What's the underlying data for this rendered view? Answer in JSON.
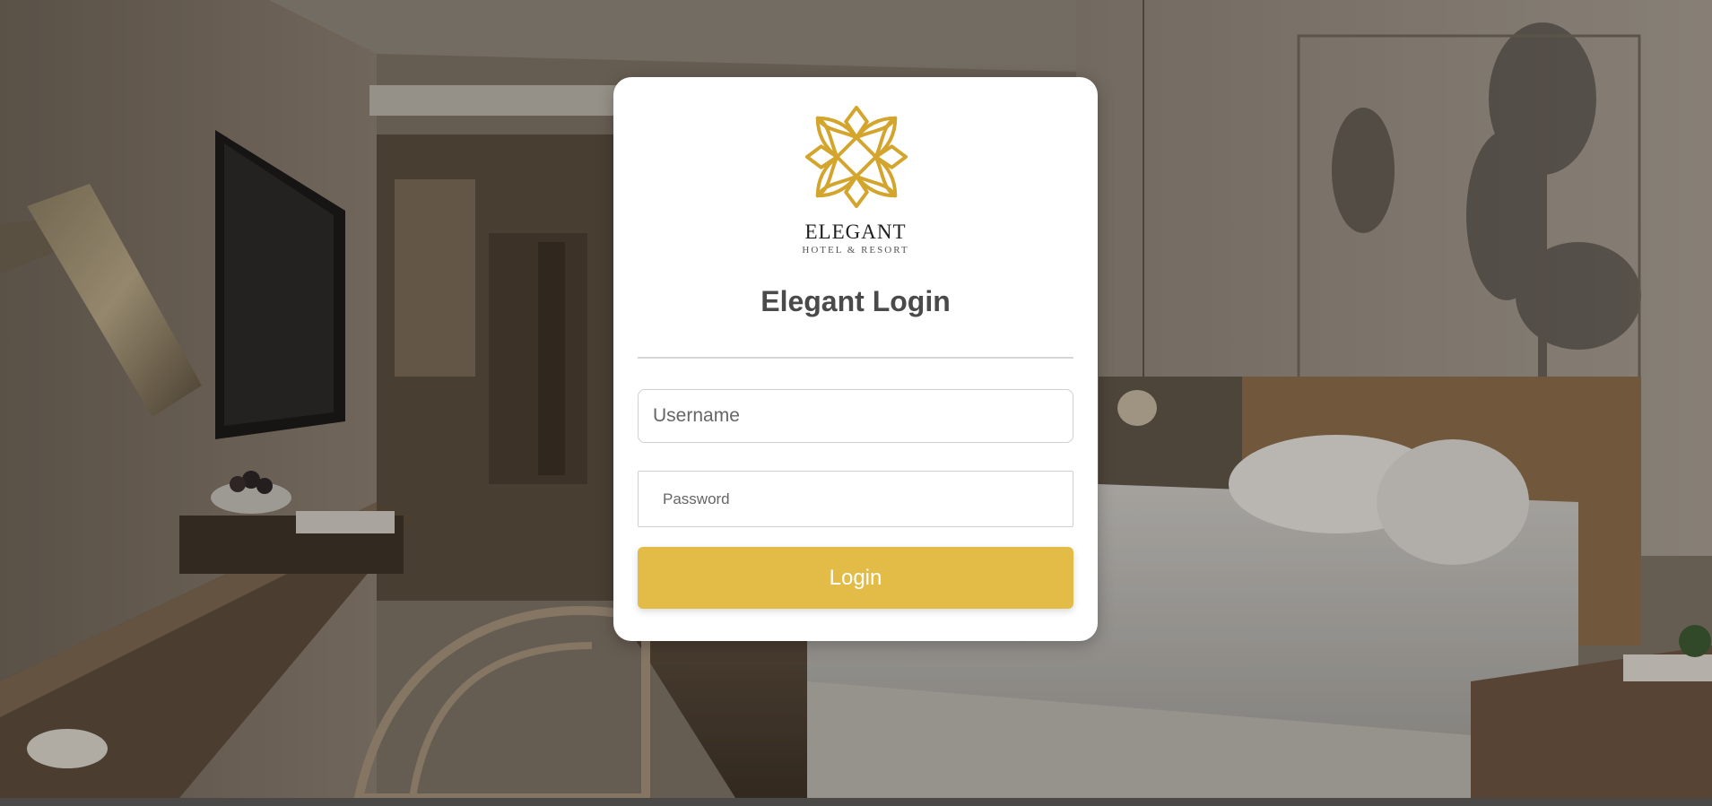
{
  "brand": {
    "name": "ELEGANT",
    "tagline": "HOTEL & RESORT",
    "logo_icon": "lotus-flower-icon",
    "logo_color": "#d4a52c"
  },
  "login": {
    "title": "Elegant Login",
    "username_placeholder": "Username",
    "password_placeholder": "Password",
    "button_label": "Login",
    "button_color": "#e2bc47"
  },
  "background": {
    "description_icon": "hotel-room-background-image"
  }
}
